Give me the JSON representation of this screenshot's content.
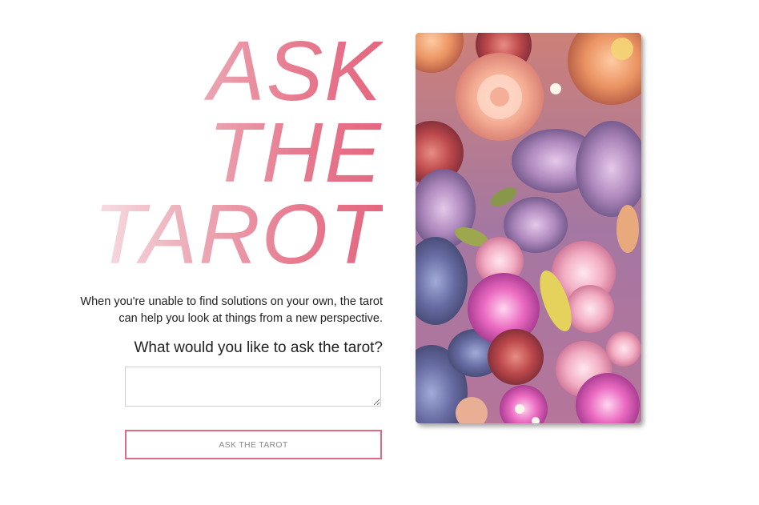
{
  "title": {
    "line1": "ASK",
    "line2": "THE",
    "line3": "TAROT"
  },
  "intro": {
    "line1": "When you're unable to find solutions on your own, the tarot",
    "line2": "can help you look at things from a new perspective."
  },
  "question": {
    "label": "What would you like to ask the tarot?",
    "value": "",
    "placeholder": ""
  },
  "button": {
    "label": "ASK THE TAROT"
  },
  "colors": {
    "accent": "#e06a83",
    "title_gradient_start": "#f7dfe4",
    "title_gradient_end": "#e3677f",
    "text": "#222222"
  },
  "image": {
    "subject": "floral-bouquet-card"
  }
}
